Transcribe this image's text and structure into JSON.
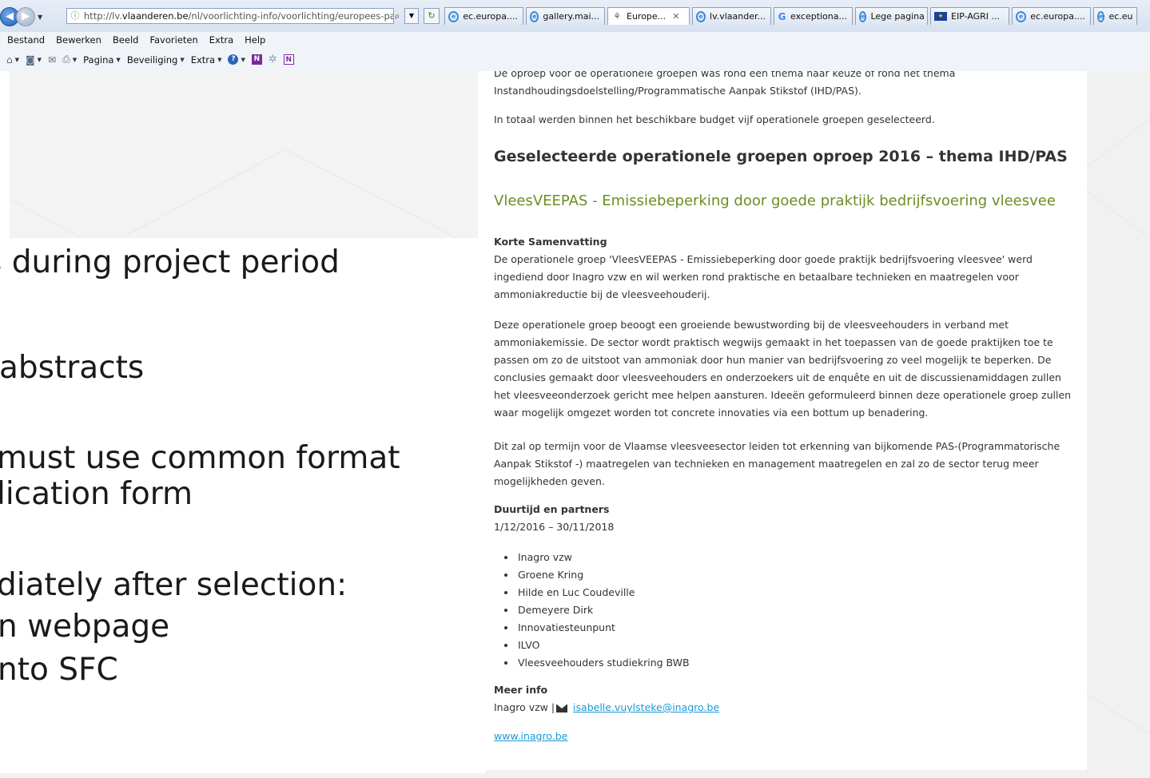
{
  "browser": {
    "url_prefix": "http://lv.",
    "url_domain": "vlaanderen.be",
    "url_path": "/nl/voorlichting-info/voorlichting/europees-pa",
    "tabs": [
      {
        "label": "ec.europa....",
        "icon": "ie-icon"
      },
      {
        "label": "gallery.mai...",
        "icon": "ie-icon"
      },
      {
        "label": "Europe...",
        "icon": "vlaanderen-icon",
        "active": true
      },
      {
        "label": "lv.vlaander...",
        "icon": "ie-icon"
      },
      {
        "label": "exceptiona...",
        "icon": "google-icon"
      },
      {
        "label": "Lege pagina",
        "icon": "ie-icon"
      },
      {
        "label": "EIP-AGRI ...",
        "icon": "eu-flag-icon"
      },
      {
        "label": "ec.europa....",
        "icon": "ie-icon"
      },
      {
        "label": "ec.eu",
        "icon": "ie-icon"
      }
    ],
    "menu": [
      "Bestand",
      "Bewerken",
      "Beeld",
      "Favorieten",
      "Extra",
      "Help"
    ],
    "commands": {
      "pagina": "Pagina",
      "beveiliging": "Beveiliging",
      "extra": "Extra"
    }
  },
  "slide": {
    "lines": [
      "s during project period",
      "abstracts",
      "must use common format",
      "lication form",
      "diately after selection:",
      "n webpage",
      "nto SFC"
    ]
  },
  "article": {
    "intro_p1": "De oproep voor de operationele groepen was rond een thema naar keuze of rond het thema Instandhoudingsdoelstelling/Programmatische Aanpak Stikstof (IHD/PAS).",
    "intro_p2": "In totaal werden binnen het beschikbare budget vijf operationele groepen geselecteerd.",
    "heading": "Geselecteerde operationele groepen oproep 2016 – thema IHD/PAS",
    "project_title": "VleesVEEPAS - Emissiebeperking door goede praktijk bedrijfsvoering vleesvee",
    "summary_label": "Korte Samenvatting",
    "summary_p1": "De operationele groep 'VleesVEEPAS - Emissiebeperking door goede praktijk bedrijfsvoering vleesvee' werd ingediend door Inagro vzw en wil werken rond praktische en betaalbare technieken en maatregelen voor ammoniakreductie bij de vleesveehouderij.",
    "summary_p2": "Deze operationele groep beoogt een groeiende bewustwording bij de vleesveehouders in verband met ammoniakemissie. De sector wordt praktisch wegwijs gemaakt in het toepassen van de goede praktijken toe te passen om zo de uitstoot van ammoniak door hun manier van bedrijfsvoering zo veel mogelijk te beperken. De conclusies gemaakt door vleesveehouders en onderzoekers uit de enquête en uit de discussienamiddagen zullen het vleesveeonderzoek gericht mee helpen aansturen. Ideeën geformuleerd binnen deze operationele groep zullen  waar mogelijk omgezet worden tot concrete innovaties via een bottum up benadering.",
    "summary_p3": "Dit zal op termijn voor de Vlaamse vleesveesector leiden tot erkenning van bijkomende PAS-(Programmatorische Aanpak Stikstof -) maatregelen van technieken en management maatregelen en zal zo de sector terug meer mogelijkheden geven.",
    "duration_label": "Duurtijd en partners",
    "duration_value": "1/12/2016 – 30/11/2018",
    "partners": [
      "Inagro vzw",
      "Groene Kring",
      "Hilde en Luc Coudeville",
      "Demeyere Dirk",
      "Innovatiesteunpunt",
      "ILVO",
      "Vleesveehouders studiekring BWB"
    ],
    "more_info_label": "Meer info",
    "contact_org": "Inagro vzw |",
    "contact_email": "isabelle.vuylsteke@inagro.be",
    "website": "www.inagro.be"
  },
  "colors": {
    "project_title": "#6b8e23",
    "link": "#1a9ad6"
  }
}
